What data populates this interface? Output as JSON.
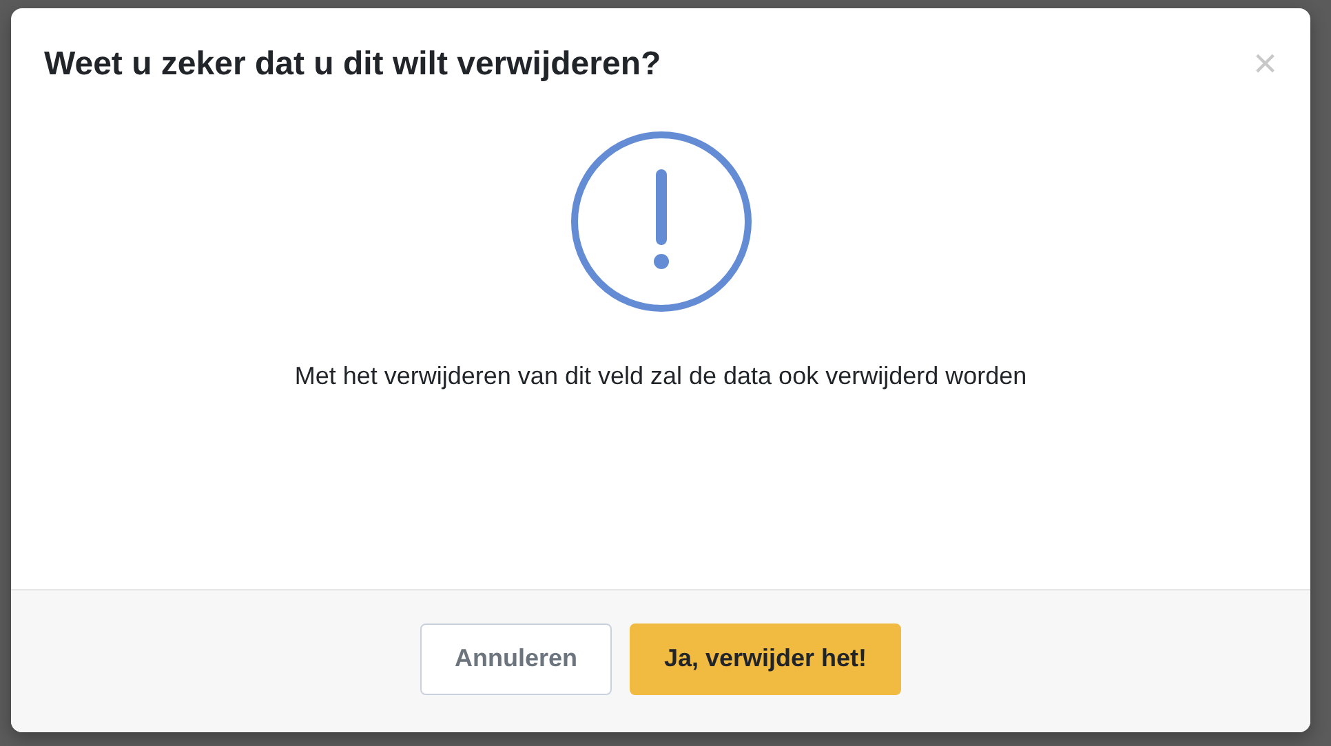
{
  "dialog": {
    "title": "Weet u zeker dat u dit wilt verwijderen?",
    "close": "×",
    "message": "Met het verwijderen van dit veld zal de data ook verwijderd worden",
    "buttons": [
      {
        "label": "Annuleren",
        "kind": "secondary"
      },
      {
        "label": "Ja, verwijder het!",
        "kind": "primary"
      }
    ]
  }
}
